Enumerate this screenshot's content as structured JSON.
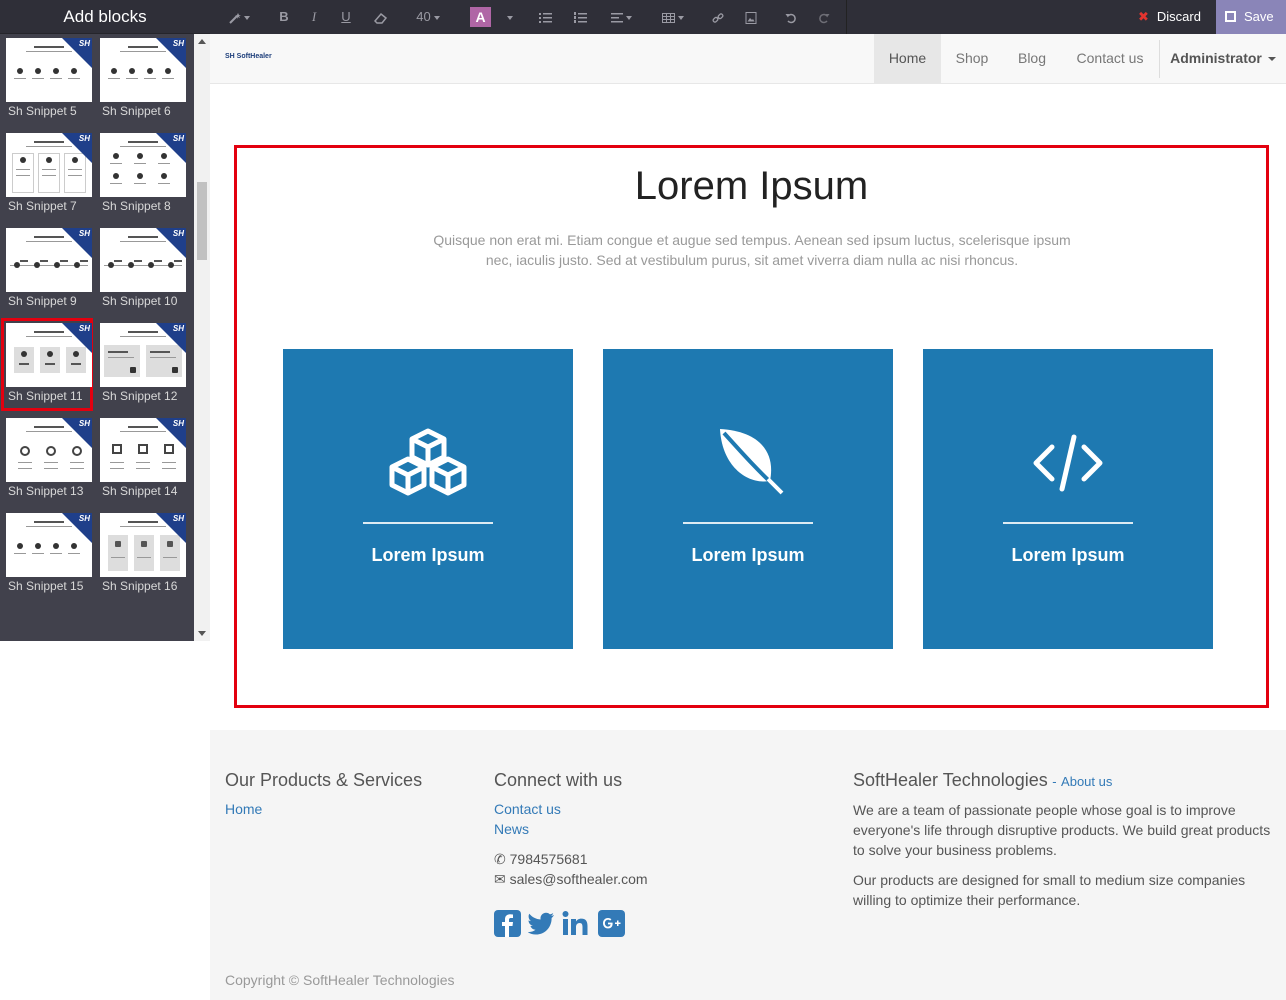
{
  "sidebar": {
    "title": "Add blocks",
    "snippets": [
      {
        "label": "Sh Snippet 5"
      },
      {
        "label": "Sh Snippet 6"
      },
      {
        "label": "Sh Snippet 7"
      },
      {
        "label": "Sh Snippet 8"
      },
      {
        "label": "Sh Snippet 9"
      },
      {
        "label": "Sh Snippet 10"
      },
      {
        "label": "Sh Snippet 11",
        "selected": true
      },
      {
        "label": "Sh Snippet 12"
      },
      {
        "label": "Sh Snippet 13"
      },
      {
        "label": "Sh Snippet 14"
      },
      {
        "label": "Sh Snippet 15"
      },
      {
        "label": "Sh Snippet 16"
      }
    ],
    "badge": "SH"
  },
  "toolbar": {
    "font_size": "40",
    "color_letter": "A",
    "bold": "B",
    "italic": "I",
    "underline": "U",
    "discard_label": "Discard",
    "save_label": "Save"
  },
  "navbar": {
    "logo_text": "SH SoftHealer",
    "items": [
      "Home",
      "Shop",
      "Blog",
      "Contact us"
    ],
    "active": "Home",
    "user": "Administrator"
  },
  "snippet": {
    "title": "Lorem Ipsum",
    "description": "Quisque non erat mi. Etiam congue et augue sed tempus. Aenean sed ipsum luctus, scelerisque ipsum nec, iaculis justo. Sed at vestibulum purus, sit amet viverra diam nulla ac nisi rhoncus.",
    "cards": [
      {
        "icon": "cubes-icon",
        "label": "Lorem Ipsum"
      },
      {
        "icon": "leaf-icon",
        "label": "Lorem Ipsum"
      },
      {
        "icon": "code-icon",
        "label": "Lorem Ipsum"
      }
    ],
    "card_color": "#1e79b1"
  },
  "footer": {
    "products_heading": "Our Products & Services",
    "products_links": [
      "Home"
    ],
    "connect_heading": "Connect with us",
    "connect_links": [
      "Contact us",
      "News"
    ],
    "phone": "7984575681",
    "email": "sales@softhealer.com",
    "company_heading": "SoftHealer Technologies",
    "about_link": "About us",
    "about_dash": "-",
    "about_p1": "We are a team of passionate people whose goal is to improve everyone's life through disruptive products. We build great products to solve your business problems.",
    "about_p2": "Our products are designed for small to medium size companies willing to optimize their performance.",
    "social": [
      "facebook-icon",
      "twitter-icon",
      "linkedin-icon",
      "google-plus-icon"
    ],
    "copyright": "Copyright © SoftHealer Technologies"
  },
  "colors": {
    "toolbar_bg": "#2f2f38",
    "selection": "#e3000f",
    "link": "#337ab7",
    "save_bg": "#8a85b8"
  }
}
